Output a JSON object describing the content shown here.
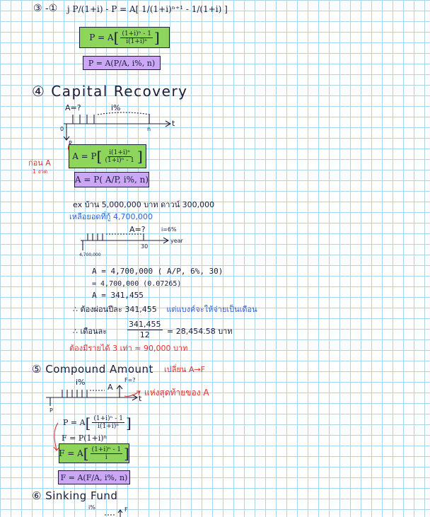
{
  "sec3": {
    "marker": "③ -①",
    "line1": "j P/(1+i) - P = A[ 1/(1+i)ⁿ⁺¹ - 1/(1+i) ]",
    "box_green": {
      "lhs": "P = A",
      "num": "(1+i)ⁿ - 1",
      "den": "i(1+i)ⁿ"
    },
    "box_purple": "P = A(P/A, i%, n)"
  },
  "sec4": {
    "title": "④ Capital Recovery",
    "diagram": {
      "a_label": "A=?",
      "rate": "i%",
      "t": "t",
      "n": "n",
      "zero": "0",
      "p": "P"
    },
    "side_note_1": "ก่อน A",
    "side_note_2": "1 งวด",
    "box_green": {
      "lhs": "A = P",
      "num": "i(1+i)ⁿ",
      "den": "(1+i)ⁿ - 1"
    },
    "box_purple": "A = P( A/P, i%, n)"
  },
  "example": {
    "line1": "ex บ้าน 5,000,000 บาท ดาวน์ 300,000",
    "line2": "เหลือยอดที่กู้ 4,700,000",
    "diagram": {
      "a_label": "A=?",
      "rate": "i=6%",
      "year": "year",
      "end": "30",
      "p": "4,700,000"
    },
    "calc1": "A = 4,700,000 ( A/P, 6%, 30)",
    "calc2": "= 4,700,000 (0.07265)",
    "calc3": "A = 341,455",
    "result_black": "∴ ต้องผ่อนปีละ 341,455",
    "result_blue": "แต่แบงค์จะให้จ่ายเป็นเดือน",
    "month_label": "∴ เดือนละ",
    "month_num": "341,455",
    "month_den": "12",
    "month_result": "= 28,454.58 บาท",
    "need_income": "ต้องมีรายได้ 3 เท่า ≈ 90,000 บาท"
  },
  "sec5": {
    "title": "⑤ Compound Amount",
    "note_red": "เปลี่ยน A→F",
    "diagram": {
      "rate": "i%",
      "a": "A",
      "f_label": "F=?",
      "t": "t",
      "p": "P"
    },
    "arrow_note": "แห่งสุดท้ายของ A",
    "formula1": {
      "lhs": "P = A",
      "num": "(1+i)ⁿ - 1",
      "den": "i(1+i)ⁿ"
    },
    "formula2": "F = P(1+i)ⁿ",
    "box_green": {
      "lhs": "F = A",
      "num": "(1+i)ⁿ - 1",
      "den": "i"
    },
    "box_purple": "F = A(F/A, i%, n)"
  },
  "sec6": {
    "title": "⑥ Sinking Fund",
    "rate": "i%",
    "f": "F"
  }
}
